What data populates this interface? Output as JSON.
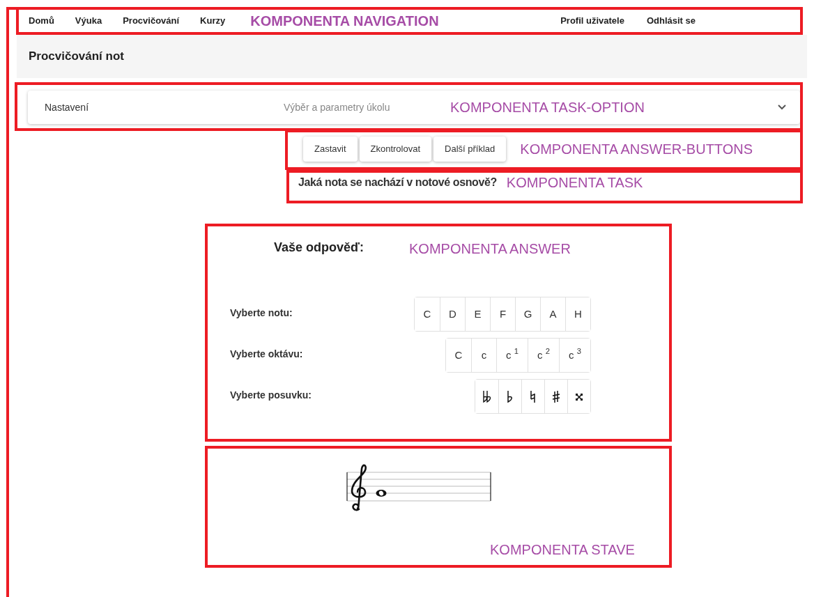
{
  "navigation": {
    "items": [
      {
        "label": "Domů"
      },
      {
        "label": "Výuka"
      },
      {
        "label": "Procvičování"
      },
      {
        "label": "Kurzy"
      }
    ],
    "user_items": [
      {
        "label": "Profil uživatele"
      },
      {
        "label": "Odhlásit se"
      }
    ],
    "annotation": "KOMPONENTA NAVIGATION"
  },
  "page_title": "Procvičování not",
  "task_option": {
    "title": "Nastavení",
    "description": "Výběr a parametry úkolu",
    "expanded": false,
    "annotation": "KOMPONENTA TASK-OPTION"
  },
  "answer_buttons": {
    "buttons": [
      "Zastavit",
      "Zkontrolovat",
      "Další příklad"
    ],
    "annotation": "KOMPONENTA ANSWER-BUTTONS"
  },
  "task": {
    "question": "Jaká nota se nachází v notové osnově?",
    "annotation": "KOMPONENTA TASK"
  },
  "answer": {
    "title": "Vaše odpověď:",
    "annotation": "KOMPONENTA ANSWER",
    "rows": [
      {
        "label": "Vyberte notu:",
        "options": [
          {
            "kind": "text",
            "text": "C"
          },
          {
            "kind": "text",
            "text": "D"
          },
          {
            "kind": "text",
            "text": "E"
          },
          {
            "kind": "text",
            "text": "F"
          },
          {
            "kind": "text",
            "text": "G"
          },
          {
            "kind": "text",
            "text": "A"
          },
          {
            "kind": "text",
            "text": "H"
          }
        ]
      },
      {
        "label": "Vyberte oktávu:",
        "options": [
          {
            "kind": "text",
            "text": "C"
          },
          {
            "kind": "text",
            "text": "c"
          },
          {
            "kind": "text",
            "text": "c $^{1}$"
          },
          {
            "kind": "text",
            "text": "c $^{2}$"
          },
          {
            "kind": "text",
            "text": "c $^{3}$"
          }
        ]
      },
      {
        "label": "Vyberte posuvku:",
        "options": [
          {
            "kind": "double-flat"
          },
          {
            "kind": "flat"
          },
          {
            "kind": "natural"
          },
          {
            "kind": "sharp"
          },
          {
            "kind": "double-sharp"
          }
        ]
      }
    ]
  },
  "stave": {
    "annotation": "KOMPONENTA STAVE"
  }
}
